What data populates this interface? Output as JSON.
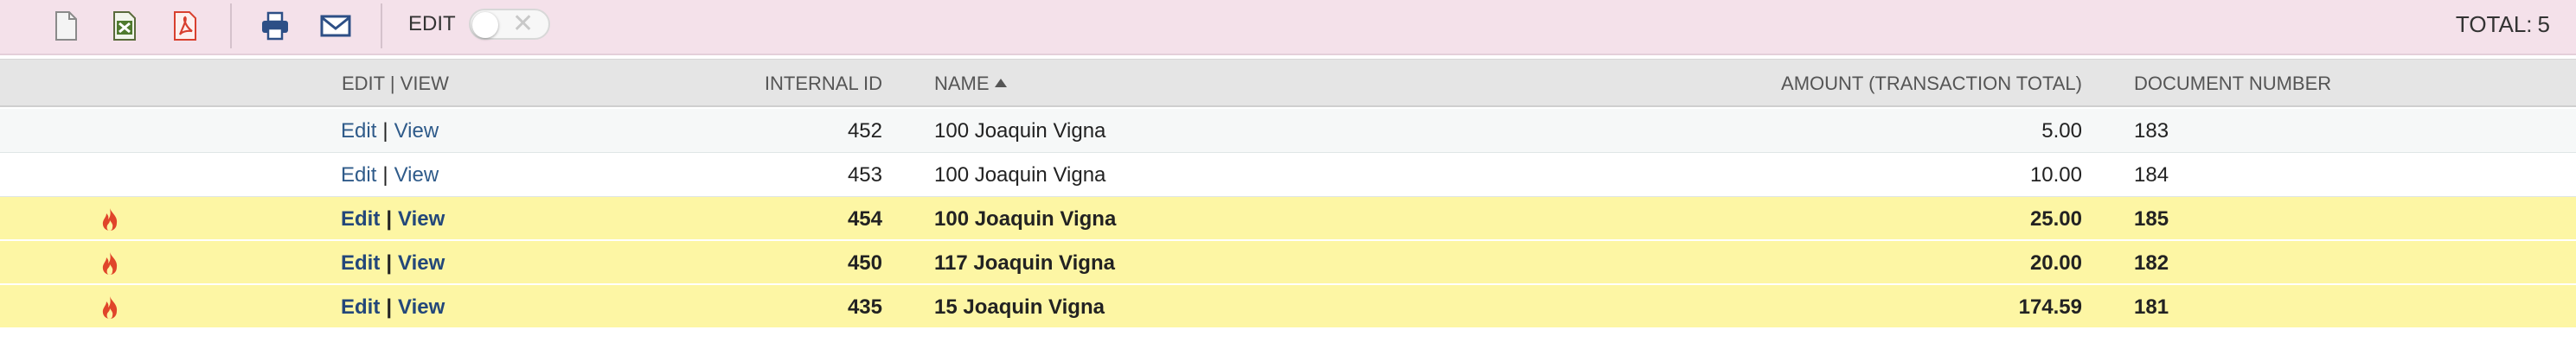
{
  "toolbar": {
    "icons": [
      "document-icon",
      "excel-icon",
      "pdf-icon",
      "print-icon",
      "email-icon"
    ],
    "edit_label": "EDIT",
    "edit_toggle_on": false,
    "total_label": "TOTAL:",
    "total_value": "5"
  },
  "table": {
    "headers": {
      "edit_view": "EDIT | VIEW",
      "internal_id": "INTERNAL ID",
      "name": "NAME",
      "amount": "AMOUNT (TRANSACTION TOTAL)",
      "document_number": "DOCUMENT NUMBER"
    },
    "sort_column": "name",
    "edit_link": "Edit",
    "view_link": "View",
    "separator": "|",
    "rows": [
      {
        "internal_id": "452",
        "name": "100 Joaquin Vigna",
        "amount": "5.00",
        "document_number": "183",
        "highlighted": false
      },
      {
        "internal_id": "453",
        "name": "100 Joaquin Vigna",
        "amount": "10.00",
        "document_number": "184",
        "highlighted": false
      },
      {
        "internal_id": "454",
        "name": "100 Joaquin Vigna",
        "amount": "25.00",
        "document_number": "185",
        "highlighted": true
      },
      {
        "internal_id": "450",
        "name": "117 Joaquin Vigna",
        "amount": "20.00",
        "document_number": "182",
        "highlighted": true
      },
      {
        "internal_id": "435",
        "name": "15 Joaquin Vigna",
        "amount": "174.59",
        "document_number": "181",
        "highlighted": true
      }
    ]
  },
  "colors": {
    "toolbar_bg": "#f4e1ea",
    "header_bg": "#e5e5e5",
    "highlight_bg": "#fdf6a4",
    "link": "#2f5b8a",
    "fire": "#e0452a"
  }
}
